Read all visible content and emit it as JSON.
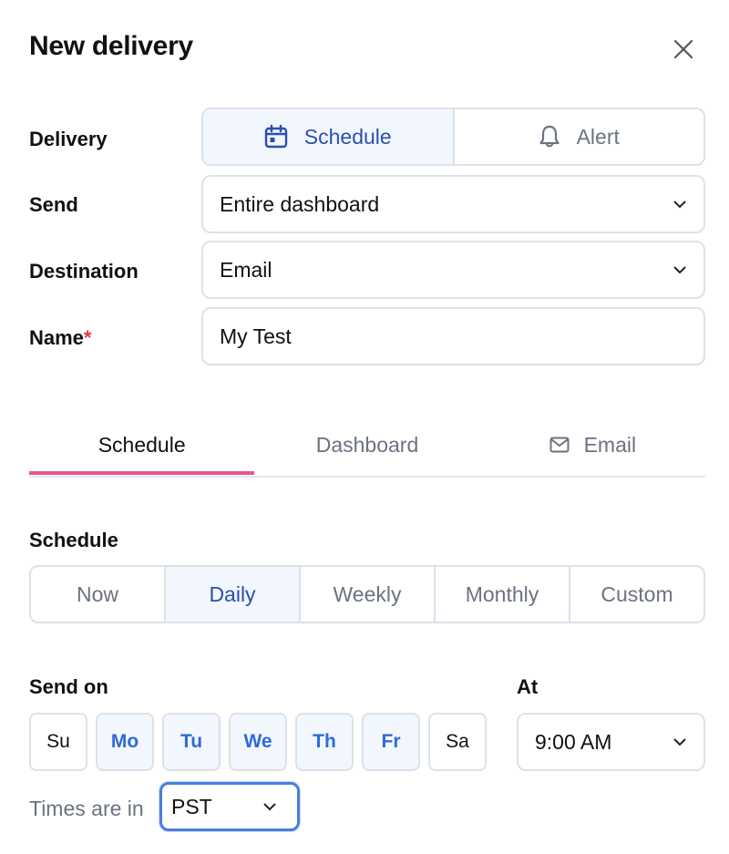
{
  "header": {
    "title": "New delivery",
    "close_icon": "close-icon"
  },
  "form": {
    "delivery": {
      "label": "Delivery",
      "options": [
        {
          "label": "Schedule",
          "icon": "calendar-icon",
          "active": true
        },
        {
          "label": "Alert",
          "icon": "bell-icon",
          "active": false
        }
      ]
    },
    "send": {
      "label": "Send",
      "value": "Entire dashboard"
    },
    "destination": {
      "label": "Destination",
      "value": "Email"
    },
    "name": {
      "label": "Name",
      "required_marker": "*",
      "value": "My Test"
    }
  },
  "tabs": [
    {
      "label": "Schedule",
      "active": true
    },
    {
      "label": "Dashboard",
      "active": false
    },
    {
      "label": "Email",
      "icon": "mail-icon",
      "active": false
    }
  ],
  "schedule": {
    "label": "Schedule",
    "options": [
      {
        "label": "Now",
        "active": false
      },
      {
        "label": "Daily",
        "active": true
      },
      {
        "label": "Weekly",
        "active": false
      },
      {
        "label": "Monthly",
        "active": false
      },
      {
        "label": "Custom",
        "active": false
      }
    ]
  },
  "send_on": {
    "label": "Send on",
    "days": [
      {
        "label": "Su",
        "selected": false
      },
      {
        "label": "Mo",
        "selected": true
      },
      {
        "label": "Tu",
        "selected": true
      },
      {
        "label": "We",
        "selected": true
      },
      {
        "label": "Th",
        "selected": true
      },
      {
        "label": "Fr",
        "selected": true
      },
      {
        "label": "Sa",
        "selected": false
      }
    ]
  },
  "at": {
    "label": "At",
    "value": "9:00 AM"
  },
  "timezone": {
    "label": "Times are in",
    "value": "PST"
  },
  "colors": {
    "accent": "#2a4fb0",
    "tab_underline": "#e8558f",
    "focus_ring": "#4a7ee0",
    "required": "#e03c3c"
  }
}
